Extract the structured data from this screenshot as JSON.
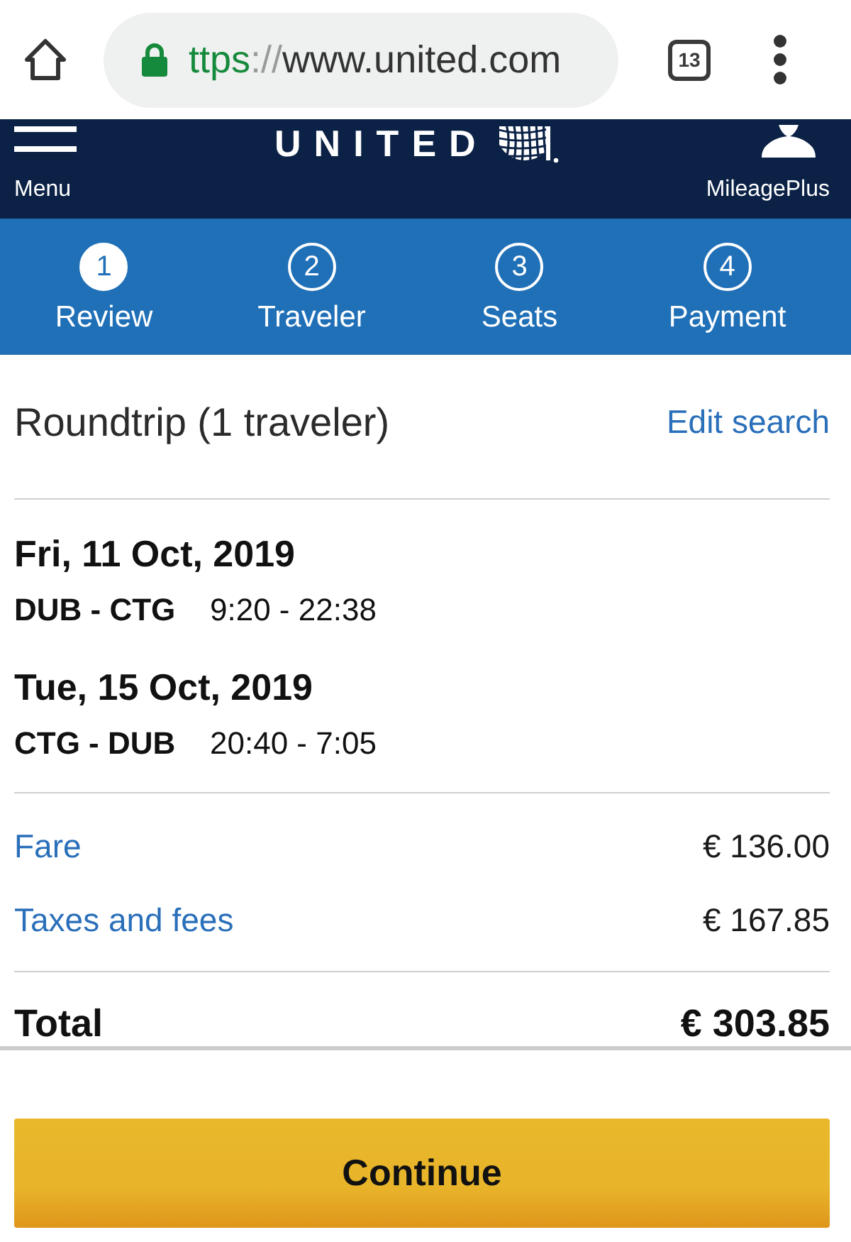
{
  "browser": {
    "url_scheme": "ttps",
    "url_separator": "://",
    "url_host": "www.united.com",
    "tab_count": "13"
  },
  "header": {
    "menu_label": "Menu",
    "logo": "UNITED",
    "account_label": "MileagePlus"
  },
  "steps": [
    {
      "number": "1",
      "label": "Review",
      "selected": true
    },
    {
      "number": "2",
      "label": "Traveler",
      "selected": false
    },
    {
      "number": "3",
      "label": "Seats",
      "selected": false
    },
    {
      "number": "4",
      "label": "Payment",
      "selected": false
    }
  ],
  "trip": {
    "title": "Roundtrip (1 traveler)",
    "edit_link": "Edit search"
  },
  "flights": [
    {
      "date": "Fri, 11 Oct, 2019",
      "route": "DUB - CTG",
      "times": "9:20 - 22:38"
    },
    {
      "date": "Tue, 15 Oct, 2019",
      "route": "CTG - DUB",
      "times": "20:40 - 7:05"
    }
  ],
  "charges": [
    {
      "label": "Fare",
      "amount": "€ 136.00"
    },
    {
      "label": "Taxes and fees",
      "amount": "€ 167.85"
    }
  ],
  "total": {
    "label": "Total",
    "amount": "€ 303.85"
  },
  "continue_button": "Continue"
}
